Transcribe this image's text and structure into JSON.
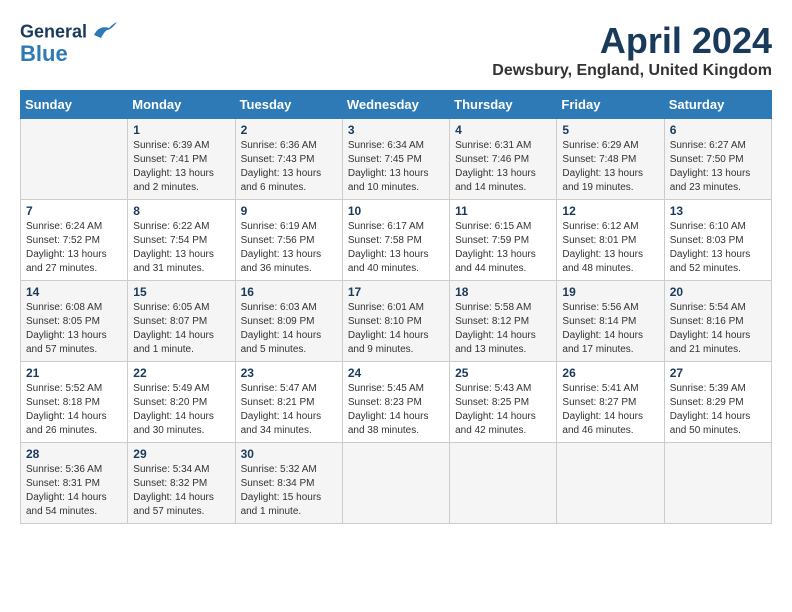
{
  "header": {
    "logo_line1": "General",
    "logo_line2": "Blue",
    "month_title": "April 2024",
    "location": "Dewsbury, England, United Kingdom"
  },
  "days_of_week": [
    "Sunday",
    "Monday",
    "Tuesday",
    "Wednesday",
    "Thursday",
    "Friday",
    "Saturday"
  ],
  "weeks": [
    [
      {
        "day": "",
        "info": ""
      },
      {
        "day": "1",
        "info": "Sunrise: 6:39 AM\nSunset: 7:41 PM\nDaylight: 13 hours\nand 2 minutes."
      },
      {
        "day": "2",
        "info": "Sunrise: 6:36 AM\nSunset: 7:43 PM\nDaylight: 13 hours\nand 6 minutes."
      },
      {
        "day": "3",
        "info": "Sunrise: 6:34 AM\nSunset: 7:45 PM\nDaylight: 13 hours\nand 10 minutes."
      },
      {
        "day": "4",
        "info": "Sunrise: 6:31 AM\nSunset: 7:46 PM\nDaylight: 13 hours\nand 14 minutes."
      },
      {
        "day": "5",
        "info": "Sunrise: 6:29 AM\nSunset: 7:48 PM\nDaylight: 13 hours\nand 19 minutes."
      },
      {
        "day": "6",
        "info": "Sunrise: 6:27 AM\nSunset: 7:50 PM\nDaylight: 13 hours\nand 23 minutes."
      }
    ],
    [
      {
        "day": "7",
        "info": "Sunrise: 6:24 AM\nSunset: 7:52 PM\nDaylight: 13 hours\nand 27 minutes."
      },
      {
        "day": "8",
        "info": "Sunrise: 6:22 AM\nSunset: 7:54 PM\nDaylight: 13 hours\nand 31 minutes."
      },
      {
        "day": "9",
        "info": "Sunrise: 6:19 AM\nSunset: 7:56 PM\nDaylight: 13 hours\nand 36 minutes."
      },
      {
        "day": "10",
        "info": "Sunrise: 6:17 AM\nSunset: 7:58 PM\nDaylight: 13 hours\nand 40 minutes."
      },
      {
        "day": "11",
        "info": "Sunrise: 6:15 AM\nSunset: 7:59 PM\nDaylight: 13 hours\nand 44 minutes."
      },
      {
        "day": "12",
        "info": "Sunrise: 6:12 AM\nSunset: 8:01 PM\nDaylight: 13 hours\nand 48 minutes."
      },
      {
        "day": "13",
        "info": "Sunrise: 6:10 AM\nSunset: 8:03 PM\nDaylight: 13 hours\nand 52 minutes."
      }
    ],
    [
      {
        "day": "14",
        "info": "Sunrise: 6:08 AM\nSunset: 8:05 PM\nDaylight: 13 hours\nand 57 minutes."
      },
      {
        "day": "15",
        "info": "Sunrise: 6:05 AM\nSunset: 8:07 PM\nDaylight: 14 hours\nand 1 minute."
      },
      {
        "day": "16",
        "info": "Sunrise: 6:03 AM\nSunset: 8:09 PM\nDaylight: 14 hours\nand 5 minutes."
      },
      {
        "day": "17",
        "info": "Sunrise: 6:01 AM\nSunset: 8:10 PM\nDaylight: 14 hours\nand 9 minutes."
      },
      {
        "day": "18",
        "info": "Sunrise: 5:58 AM\nSunset: 8:12 PM\nDaylight: 14 hours\nand 13 minutes."
      },
      {
        "day": "19",
        "info": "Sunrise: 5:56 AM\nSunset: 8:14 PM\nDaylight: 14 hours\nand 17 minutes."
      },
      {
        "day": "20",
        "info": "Sunrise: 5:54 AM\nSunset: 8:16 PM\nDaylight: 14 hours\nand 21 minutes."
      }
    ],
    [
      {
        "day": "21",
        "info": "Sunrise: 5:52 AM\nSunset: 8:18 PM\nDaylight: 14 hours\nand 26 minutes."
      },
      {
        "day": "22",
        "info": "Sunrise: 5:49 AM\nSunset: 8:20 PM\nDaylight: 14 hours\nand 30 minutes."
      },
      {
        "day": "23",
        "info": "Sunrise: 5:47 AM\nSunset: 8:21 PM\nDaylight: 14 hours\nand 34 minutes."
      },
      {
        "day": "24",
        "info": "Sunrise: 5:45 AM\nSunset: 8:23 PM\nDaylight: 14 hours\nand 38 minutes."
      },
      {
        "day": "25",
        "info": "Sunrise: 5:43 AM\nSunset: 8:25 PM\nDaylight: 14 hours\nand 42 minutes."
      },
      {
        "day": "26",
        "info": "Sunrise: 5:41 AM\nSunset: 8:27 PM\nDaylight: 14 hours\nand 46 minutes."
      },
      {
        "day": "27",
        "info": "Sunrise: 5:39 AM\nSunset: 8:29 PM\nDaylight: 14 hours\nand 50 minutes."
      }
    ],
    [
      {
        "day": "28",
        "info": "Sunrise: 5:36 AM\nSunset: 8:31 PM\nDaylight: 14 hours\nand 54 minutes."
      },
      {
        "day": "29",
        "info": "Sunrise: 5:34 AM\nSunset: 8:32 PM\nDaylight: 14 hours\nand 57 minutes."
      },
      {
        "day": "30",
        "info": "Sunrise: 5:32 AM\nSunset: 8:34 PM\nDaylight: 15 hours\nand 1 minute."
      },
      {
        "day": "",
        "info": ""
      },
      {
        "day": "",
        "info": ""
      },
      {
        "day": "",
        "info": ""
      },
      {
        "day": "",
        "info": ""
      }
    ]
  ]
}
